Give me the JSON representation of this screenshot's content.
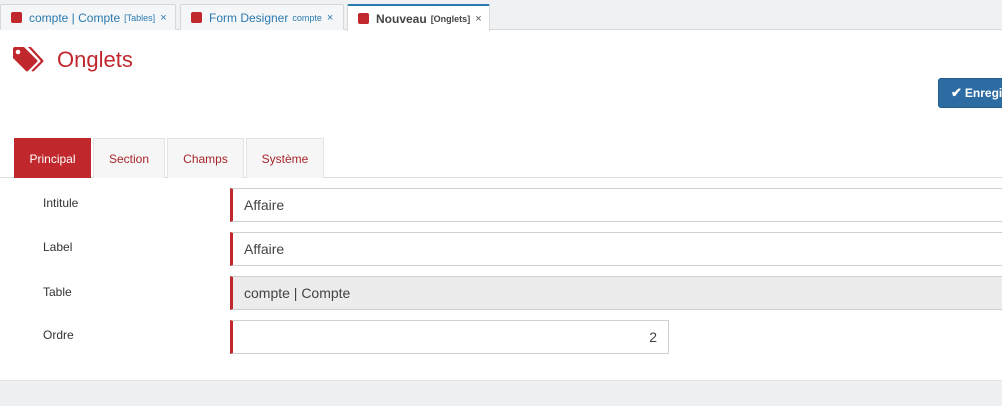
{
  "doc_tabs": [
    {
      "title": "compte | Compte",
      "subtitle": "[Tables]",
      "close": "×"
    },
    {
      "title": "Form Designer",
      "subtitle": "compte",
      "close": "×"
    },
    {
      "title": "Nouveau",
      "subtitle": "[Onglets]",
      "close": "×"
    }
  ],
  "header": {
    "icon": "tags-icon",
    "title": "Onglets"
  },
  "toolbar": {
    "save_icon": "✔",
    "save_label": "Enregistrer"
  },
  "form_tabs": [
    {
      "label": "Principal",
      "active": true
    },
    {
      "label": "Section",
      "active": false
    },
    {
      "label": "Champs",
      "active": false
    },
    {
      "label": "Système",
      "active": false
    }
  ],
  "form": {
    "intitule": {
      "label": "Intitule",
      "value": "Affaire"
    },
    "label": {
      "label": "Label",
      "value": "Affaire"
    },
    "table": {
      "label": "Table",
      "value": "compte | Compte"
    },
    "ordre": {
      "label": "Ordre",
      "value": "2"
    }
  },
  "colors": {
    "accent": "#c0282d",
    "link": "#2a7ab0",
    "primary_button": "#2d6ca2"
  }
}
